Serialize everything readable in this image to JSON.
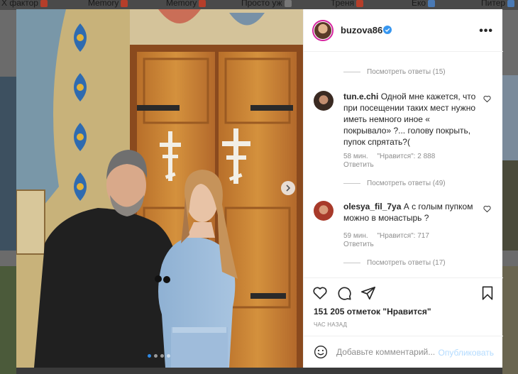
{
  "background_tabs": [
    {
      "label": "Х фактор"
    },
    {
      "label": "Memory"
    },
    {
      "label": "Memory"
    },
    {
      "label": "Просто уж"
    },
    {
      "label": "Треня"
    },
    {
      "label": "Еко"
    },
    {
      "label": "Питер"
    }
  ],
  "post": {
    "author": "buzova86",
    "carousel": {
      "total": 4,
      "current": 1
    },
    "likes_text": "151 205 отметок \"Нравится\"",
    "time_text": "ЧАС НАЗАД"
  },
  "comments": {
    "view_replies_1": "Посмотреть ответы (15)",
    "items": [
      {
        "username": "tun.e.chi",
        "text": "Одной мне кажется, что при посещении таких мест нужно иметь немного иное « покрывало» ?... голову покрыть, пупок спрятать?(",
        "time": "58 мин.",
        "likes": "\"Нравится\": 2 888",
        "reply": "Ответить",
        "view_replies": "Посмотреть ответы (49)"
      },
      {
        "username": "olesya_fil_7ya",
        "text": "А с голым пупком можно в монастырь ?",
        "time": "59 мин.",
        "likes": "\"Нравится\": 717",
        "reply": "Ответить",
        "view_replies": "Посмотреть ответы (17)"
      }
    ]
  },
  "comment_box": {
    "placeholder": "Добавьте комментарий...",
    "publish_label": "Опубликовать"
  },
  "colors": {
    "verified": "#3897f0",
    "publish_disabled": "#b3dbff",
    "muted": "#8e8e8e",
    "text": "#262626"
  },
  "icons": {
    "like": "heart-icon",
    "comment": "comment-icon",
    "share": "paper-plane-icon",
    "save": "bookmark-icon",
    "emoji": "smile-icon",
    "more": "more-dots-icon",
    "next": "chevron-right-icon",
    "verified": "verified-badge-icon"
  }
}
